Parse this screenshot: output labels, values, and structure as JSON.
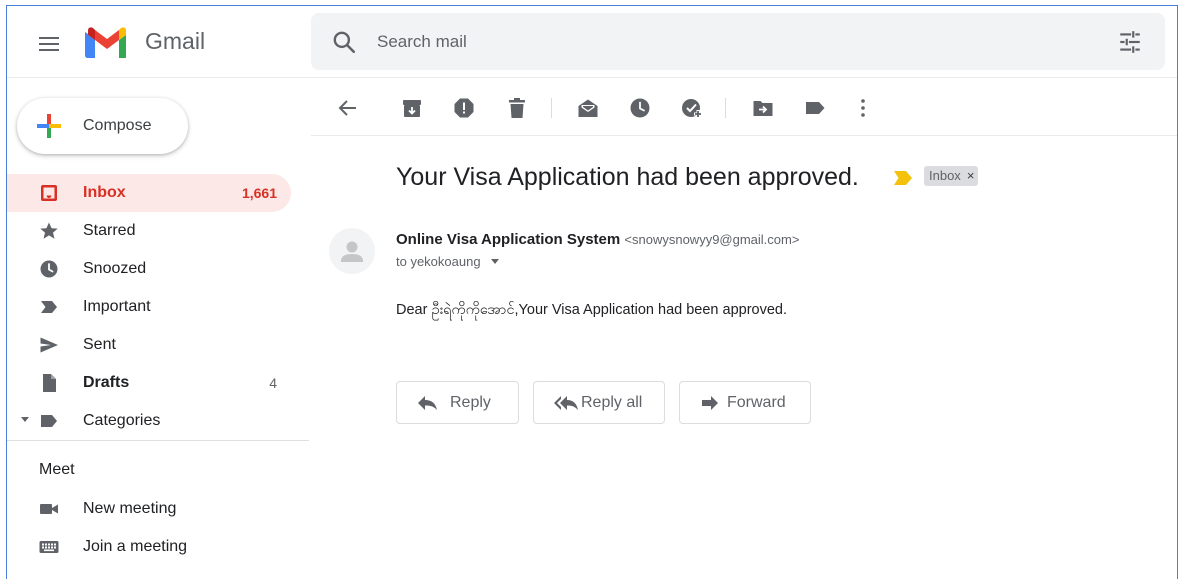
{
  "header": {
    "app_name": "Gmail",
    "search_placeholder": "Search mail"
  },
  "compose": {
    "label": "Compose"
  },
  "nav": {
    "items": [
      {
        "label": "Inbox",
        "count": "1,661",
        "icon": "inbox-icon",
        "active": true
      },
      {
        "label": "Starred",
        "count": "",
        "icon": "star-icon"
      },
      {
        "label": "Snoozed",
        "count": "",
        "icon": "clock-icon"
      },
      {
        "label": "Important",
        "count": "",
        "icon": "important-icon"
      },
      {
        "label": "Sent",
        "count": "",
        "icon": "send-icon"
      },
      {
        "label": "Drafts",
        "count": "4",
        "icon": "draft-icon"
      },
      {
        "label": "Categories",
        "count": "",
        "icon": "label-icon"
      }
    ]
  },
  "meet": {
    "title": "Meet",
    "new_meeting": "New meeting",
    "join_meeting": "Join a meeting"
  },
  "message": {
    "subject": "Your Visa Application had been approved.",
    "label_chip": "Inbox",
    "label_close": "×",
    "sender_name": "Online Visa Application System",
    "sender_email": "<snowysnowyy9@gmail.com>",
    "to_line": "to yekokoaung",
    "body": "Dear ဦးရဲကိုကိုအောင်,Your Visa Application had been approved."
  },
  "actions": {
    "reply": "Reply",
    "reply_all": "Reply all",
    "forward": "Forward"
  },
  "colors": {
    "accent_red": "#d93025",
    "active_bg": "#fce8e6",
    "icon_gray": "#5f6368",
    "important_yellow": "#f4c20d"
  }
}
